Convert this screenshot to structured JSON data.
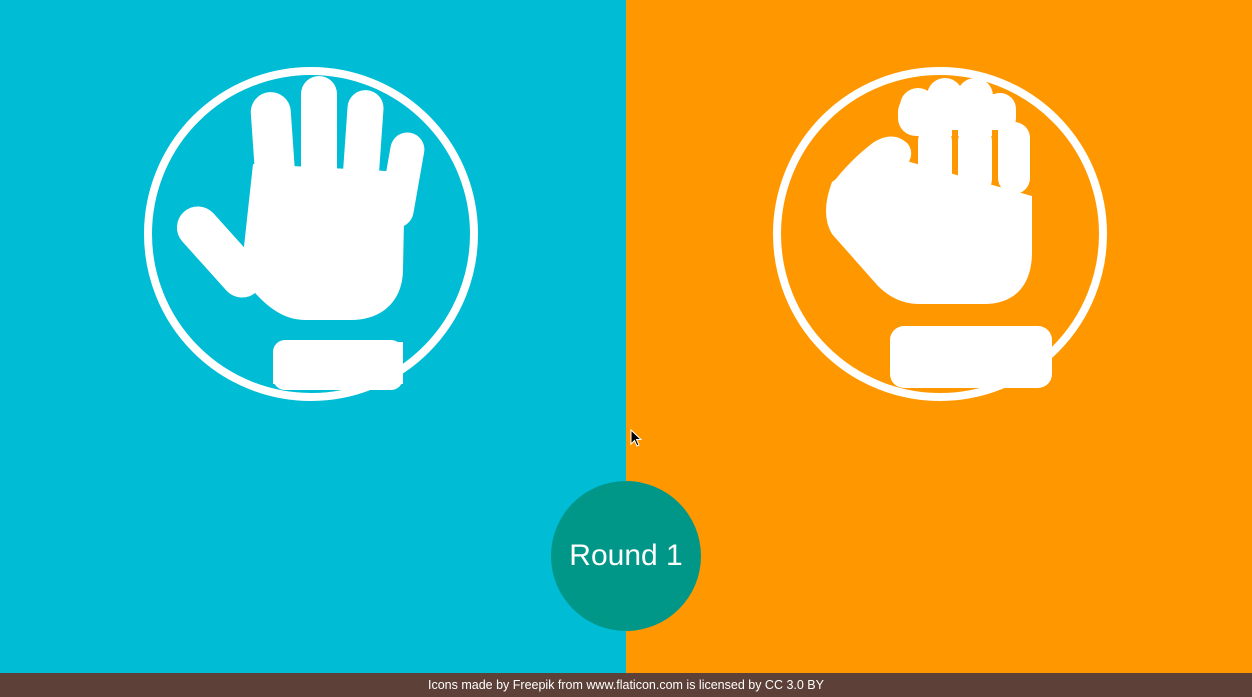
{
  "colors": {
    "player_panel": "#00BCD4",
    "computer_panel": "#FF9800",
    "round_badge": "#009688",
    "footer": "#5D4037",
    "icon": "#FFFFFF"
  },
  "player": {
    "choice_icon": "paper-hand-icon"
  },
  "computer": {
    "choice_icon": "rock-fist-icon"
  },
  "round": {
    "label": "Round 1"
  },
  "footer": {
    "credit": "Icons made by Freepik from www.flaticon.com is licensed by CC 3.0 BY"
  }
}
